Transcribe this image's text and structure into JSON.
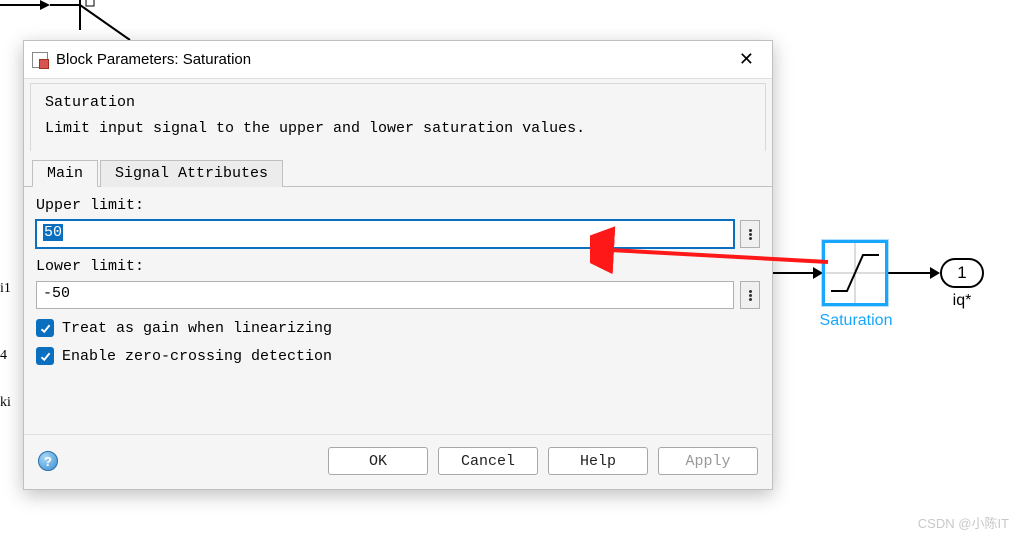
{
  "dialog": {
    "title": "Block Parameters: Saturation",
    "block_type": "Saturation",
    "description": "Limit input signal to the upper and lower saturation values.",
    "tabs": [
      {
        "label": "Main"
      },
      {
        "label": "Signal Attributes"
      }
    ],
    "fields": {
      "upper_label": "Upper limit:",
      "upper_value": "50",
      "lower_label": "Lower limit:",
      "lower_value": "-50"
    },
    "checks": {
      "gain_label": "Treat as gain when linearizing",
      "zc_label": "Enable zero-crossing detection"
    },
    "buttons": {
      "ok": "OK",
      "cancel": "Cancel",
      "help": "Help",
      "apply": "Apply"
    }
  },
  "canvas": {
    "block_label": "Saturation",
    "outport_number": "1",
    "outport_name": "iq*",
    "side_labels": {
      "i1": "i1",
      "four": "4",
      "ki": "ki"
    }
  },
  "watermark": "CSDN @小陈IT"
}
